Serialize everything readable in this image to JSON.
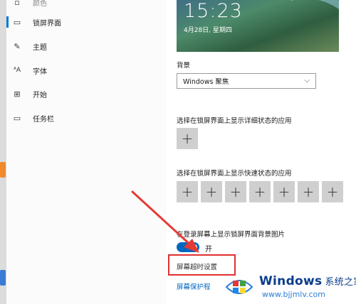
{
  "nav": {
    "items": [
      {
        "label": "锁屏界面",
        "icon": "lock-screen-icon"
      },
      {
        "label": "主题",
        "icon": "theme-icon"
      },
      {
        "label": "字体",
        "icon": "font-icon"
      },
      {
        "label": "开始",
        "icon": "start-icon"
      },
      {
        "label": "任务栏",
        "icon": "taskbar-icon"
      }
    ],
    "top_partial": "颜色"
  },
  "preview": {
    "time": "15:23",
    "date": "4月28日, 星期四"
  },
  "background": {
    "label": "背景",
    "selected": "Windows 聚焦"
  },
  "detailed_status": {
    "label": "选择在锁屏界面上显示详细状态的应用"
  },
  "quick_status": {
    "label": "选择在锁屏界面上显示快速状态的应用",
    "count": 7
  },
  "signin_background": {
    "label": "在登录屏幕上显示锁屏界面背景图片",
    "state": "开"
  },
  "links": {
    "timeout": "屏幕超时设置",
    "screensaver": "屏幕保护程"
  },
  "watermark": {
    "title": "Windows",
    "subtitle": "系统之家",
    "url": "www.bjjmlv.com"
  },
  "colors": {
    "accent": "#0067c0",
    "highlight": "#e03030"
  }
}
